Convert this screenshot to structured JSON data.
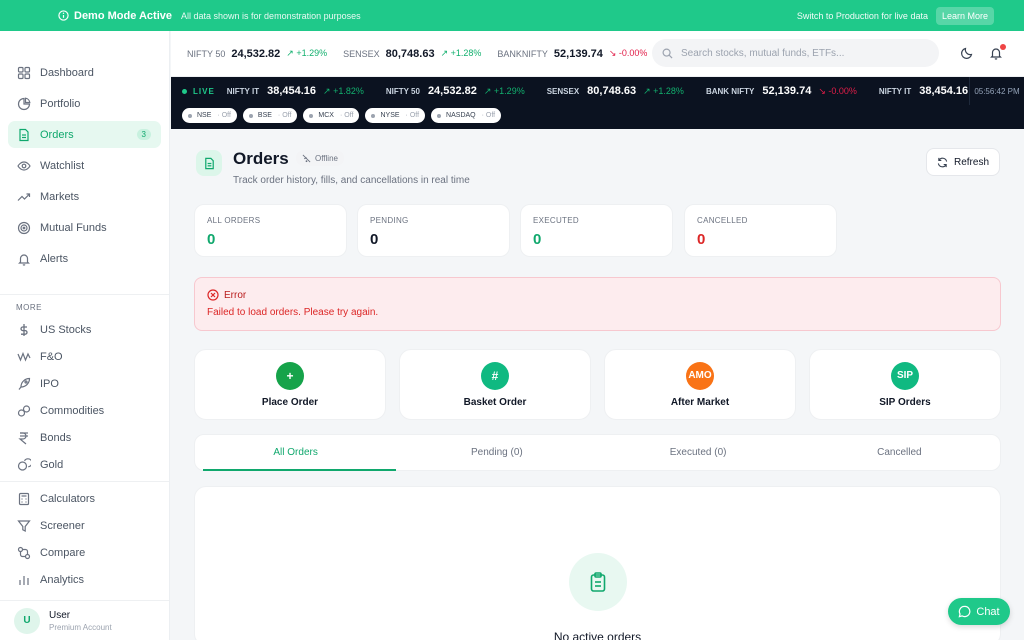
{
  "banner": {
    "title": "Demo Mode Active",
    "subtitle": "All data shown is for demonstration purposes",
    "switch_text": "Switch to Production for live data",
    "learn_more": "Learn More"
  },
  "sidebar": {
    "items": [
      {
        "label": "Dashboard",
        "icon": "grid-icon"
      },
      {
        "label": "Portfolio",
        "icon": "pie-chart-icon"
      },
      {
        "label": "Orders",
        "icon": "document-icon",
        "count": "3"
      },
      {
        "label": "Watchlist",
        "icon": "eye-icon"
      },
      {
        "label": "Markets",
        "icon": "trend-icon"
      },
      {
        "label": "Mutual Funds",
        "icon": "target-icon"
      },
      {
        "label": "Alerts",
        "icon": "bell-icon"
      }
    ],
    "more_label": "MORE",
    "more_items": [
      {
        "label": "US Stocks",
        "icon": "dollar-icon"
      },
      {
        "label": "F&O",
        "icon": "wave-icon"
      },
      {
        "label": "IPO",
        "icon": "rocket-icon"
      },
      {
        "label": "Commodities",
        "icon": "flask-icon"
      },
      {
        "label": "Bonds",
        "icon": "rupee-icon"
      },
      {
        "label": "Gold",
        "icon": "coin-icon"
      },
      {
        "label": "Calculators",
        "icon": "calculator-icon"
      },
      {
        "label": "Screener",
        "icon": "filter-icon"
      },
      {
        "label": "Compare",
        "icon": "compare-icon"
      },
      {
        "label": "Analytics",
        "icon": "chart-icon"
      }
    ],
    "user": {
      "initial": "U",
      "name": "User",
      "plan": "Premium Account"
    }
  },
  "header": {
    "quotes": [
      {
        "name": "NIFTY 50",
        "value": "24,532.82",
        "change": "+1.29%",
        "dir": "up"
      },
      {
        "name": "SENSEX",
        "value": "80,748.63",
        "change": "+1.28%",
        "dir": "up"
      },
      {
        "name": "BANKNIFTY",
        "value": "52,139.74",
        "change": "-0.00%",
        "dir": "down"
      }
    ],
    "search_placeholder": "Search stocks, mutual funds, ETFs..."
  },
  "ticker": {
    "live_label": "LIVE",
    "quotes": [
      {
        "name": "NIFTY IT",
        "value": "38,454.16",
        "change": "+1.82%",
        "dir": "up"
      },
      {
        "name": "NIFTY 50",
        "value": "24,532.82",
        "change": "+1.29%",
        "dir": "up"
      },
      {
        "name": "SENSEX",
        "value": "80,748.63",
        "change": "+1.28%",
        "dir": "up"
      },
      {
        "name": "BANK NIFTY",
        "value": "52,139.74",
        "change": "-0.00%",
        "dir": "down"
      },
      {
        "name": "NIFTY IT",
        "value": "38,454.16",
        "change": "",
        "dir": "up"
      }
    ],
    "time": "05:56:42 PM",
    "exchanges": [
      {
        "name": "NSE",
        "status": "Off"
      },
      {
        "name": "BSE",
        "status": "Off"
      },
      {
        "name": "MCX",
        "status": "Off"
      },
      {
        "name": "NYSE",
        "status": "Off"
      },
      {
        "name": "NASDAQ",
        "status": "Off"
      }
    ]
  },
  "page": {
    "title": "Orders",
    "status": "Offline",
    "subtitle": "Track order history, fills, and cancellations in real time",
    "refresh": "Refresh"
  },
  "stats": [
    {
      "label": "ALL ORDERS",
      "value": "0",
      "color": "#10a86d"
    },
    {
      "label": "PENDING",
      "value": "0",
      "color": "#111827"
    },
    {
      "label": "EXECUTED",
      "value": "0",
      "color": "#10a86d"
    },
    {
      "label": "CANCELLED",
      "value": "0",
      "color": "#dc2626"
    }
  ],
  "error": {
    "title": "Error",
    "message": "Failed to load orders. Please try again."
  },
  "actions": [
    {
      "label": "Place Order",
      "glyph": "+",
      "color": "#16a34a"
    },
    {
      "label": "Basket Order",
      "glyph": "#",
      "color": "#10b981"
    },
    {
      "label": "After Market",
      "glyph": "AMO",
      "color": "#f97316"
    },
    {
      "label": "SIP Orders",
      "glyph": "SIP",
      "color": "#10b981"
    }
  ],
  "tabs": [
    {
      "label": "All Orders",
      "active": true
    },
    {
      "label": "Pending (0)",
      "active": false
    },
    {
      "label": "Executed (0)",
      "active": false
    },
    {
      "label": "Cancelled",
      "active": false
    }
  ],
  "empty": {
    "text": "No active orders"
  },
  "chat": {
    "label": "Chat"
  }
}
